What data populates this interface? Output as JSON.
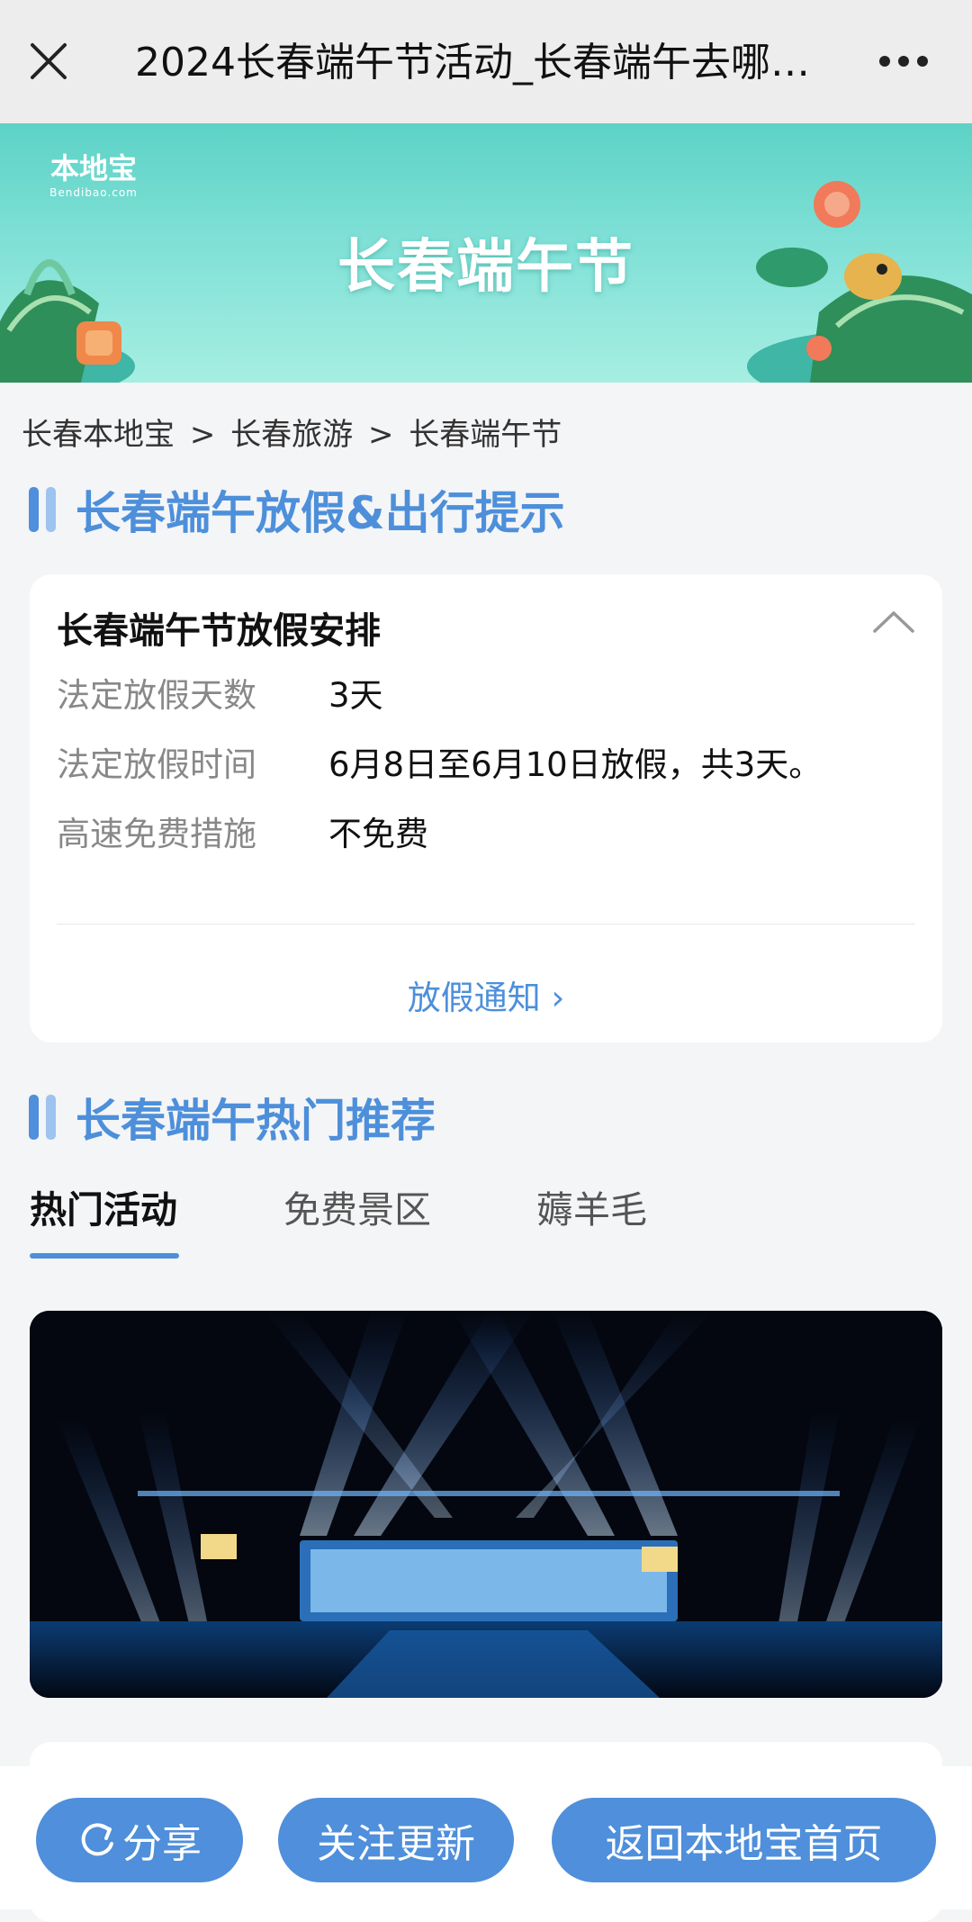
{
  "nav": {
    "title": "2024长春端午节活动_长春端午去哪…",
    "close_icon": "close-icon",
    "more_icon": "more-icon"
  },
  "banner": {
    "logo_text": "本地宝",
    "logo_sub": "Bendibao.com",
    "title": "长春端午节"
  },
  "breadcrumb": [
    "长春本地宝",
    ">",
    "长春旅游",
    ">",
    "长春端午节"
  ],
  "section1": {
    "title": "长春端午放假&出行提示"
  },
  "holiday_card": {
    "title": "长春端午节放假安排",
    "rows": [
      {
        "label": "法定放假天数",
        "value": "3天"
      },
      {
        "label": "法定放假时间",
        "value": "6月8日至6月10日放假，共3天。"
      },
      {
        "label": "高速免费措施",
        "value": "不免费"
      }
    ],
    "link_label": "放假通知 ›"
  },
  "section2": {
    "title": "长春端午热门推荐"
  },
  "tabs": [
    {
      "label": "热门活动",
      "active": true
    },
    {
      "label": "免费景区",
      "active": false
    },
    {
      "label": "薅羊毛",
      "active": false
    }
  ],
  "bottom_bar": {
    "share_label": "分享",
    "follow_label": "关注更新",
    "home_label": "返回本地宝首页"
  },
  "colors": {
    "accent": "#4f8fdb",
    "banner_teal": "#5dd2c6",
    "nav_bg": "#ededed"
  }
}
